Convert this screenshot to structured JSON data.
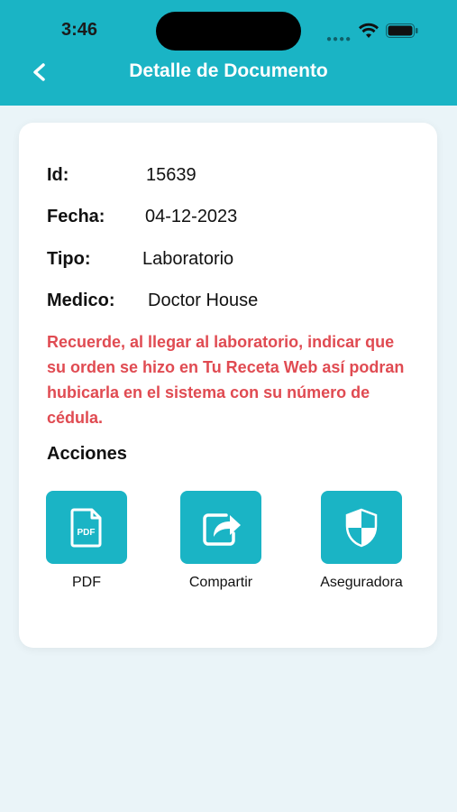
{
  "status_bar": {
    "time": "3:46"
  },
  "header": {
    "title": "Detalle de Documento"
  },
  "details": {
    "id": {
      "label": "Id:",
      "value": "15639"
    },
    "fecha": {
      "label": "Fecha:",
      "value": "04-12-2023"
    },
    "tipo": {
      "label": "Tipo:",
      "value": "Laboratorio"
    },
    "medico": {
      "label": "Medico:",
      "value": "Doctor House"
    }
  },
  "notice": "Recuerde, al llegar al laboratorio, indicar que su orden se hizo en Tu Receta Web así podran hubicarla en el sistema con su número de cédula.",
  "actions": {
    "title": "Acciones",
    "items": [
      {
        "label": "PDF",
        "icon": "pdf-file-icon",
        "icon_text": "PDF"
      },
      {
        "label": "Compartir",
        "icon": "share-icon"
      },
      {
        "label": "Aseguradora",
        "icon": "shield-icon"
      }
    ]
  },
  "colors": {
    "accent": "#1ab4c5",
    "notice": "#e04b52",
    "background": "#eaf4f8"
  }
}
